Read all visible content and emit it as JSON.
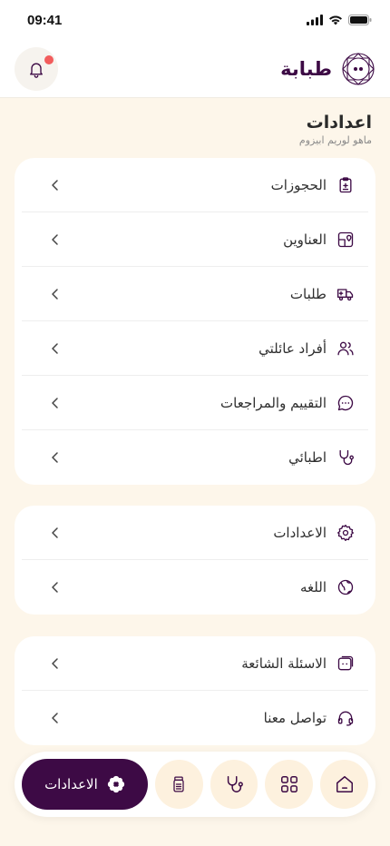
{
  "status_bar": {
    "time": "09:41"
  },
  "header": {
    "brand_name": "طبابة",
    "notification_badge": true
  },
  "page": {
    "title": "اعدادات",
    "subtitle": "ماهو لوريم ابيزوم"
  },
  "groups": [
    {
      "items": [
        {
          "label": "الحجوزات",
          "icon": "clipboard-icon"
        },
        {
          "label": "العناوين",
          "icon": "map-pin-icon"
        },
        {
          "label": "طلبات",
          "icon": "truck-icon"
        },
        {
          "label": "أفراد عائلتي",
          "icon": "users-icon"
        },
        {
          "label": "التقييم والمراجعات",
          "icon": "chat-bubble-icon"
        },
        {
          "label": "اطبائي",
          "icon": "stethoscope-icon"
        }
      ]
    },
    {
      "items": [
        {
          "label": "الاعدادات",
          "icon": "gear-icon"
        },
        {
          "label": "اللغه",
          "icon": "globe-icon"
        }
      ]
    },
    {
      "items": [
        {
          "label": "الاسئلة الشائعة",
          "icon": "faq-icon"
        },
        {
          "label": "تواصل معنا",
          "icon": "headset-icon"
        }
      ]
    }
  ],
  "bottom_nav": {
    "active_label": "الاعدادات",
    "items": [
      "settings-flower-icon",
      "medicine-bottle-icon",
      "stethoscope-icon",
      "grid-icon",
      "home-icon"
    ]
  },
  "colors": {
    "brand": "#3d0a45",
    "background": "#fdf6ea",
    "badge": "#f25c5c",
    "nav_circle": "#fdf1de"
  }
}
